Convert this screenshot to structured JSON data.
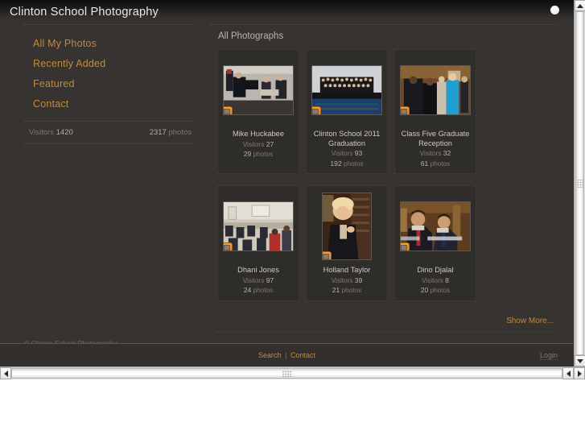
{
  "site": {
    "title": "Clinton School Photography",
    "copyright": "© Clinton School Photography"
  },
  "sidebar": {
    "nav": [
      {
        "label": "All My Photos"
      },
      {
        "label": "Recently Added"
      },
      {
        "label": "Featured"
      },
      {
        "label": "Contact"
      }
    ],
    "stats": {
      "visitors_label": "Visitors",
      "visitors_count": "1420",
      "photos_count": "2317",
      "photos_label": "photos"
    }
  },
  "main": {
    "heading": "All Photographs",
    "show_more": "Show More...",
    "albums": [
      {
        "title": "Mike Huckabee",
        "visitors_label": "Visitors",
        "visitors": "27",
        "photos": "29",
        "photos_label": "photos",
        "orientation": "landscape",
        "badge": "album-badge-icon"
      },
      {
        "title": "Clinton School 2011 Graduation",
        "visitors_label": "Visitors",
        "visitors": "93",
        "photos": "192",
        "photos_label": "photos",
        "orientation": "landscape",
        "badge": "album-badge-icon"
      },
      {
        "title": "Class Five Graduate Reception",
        "visitors_label": "Visitors",
        "visitors": "32",
        "photos": "61",
        "photos_label": "photos",
        "orientation": "landscape",
        "badge": "album-badge-icon"
      },
      {
        "title": "Dhani Jones",
        "visitors_label": "Visitors",
        "visitors": "97",
        "photos": "24",
        "photos_label": "photos",
        "orientation": "landscape",
        "badge": "album-badge-icon"
      },
      {
        "title": "Holland Taylor",
        "visitors_label": "Visitors",
        "visitors": "39",
        "photos": "21",
        "photos_label": "photos",
        "orientation": "portrait",
        "badge": "album-badge-icon"
      },
      {
        "title": "Dino Djalal",
        "visitors_label": "Visitors",
        "visitors": "8",
        "photos": "20",
        "photos_label": "photos",
        "orientation": "landscape",
        "badge": "album-badge-icon"
      }
    ]
  },
  "footer": {
    "search": "Search",
    "separator": "|",
    "contact": "Contact",
    "login": "Login"
  },
  "colors": {
    "page_bg": "#363330",
    "card_bg": "#2f2d2a",
    "accent": "#c08b3e",
    "title_text": "#e8e8e6",
    "muted_text": "#7f7a73"
  }
}
